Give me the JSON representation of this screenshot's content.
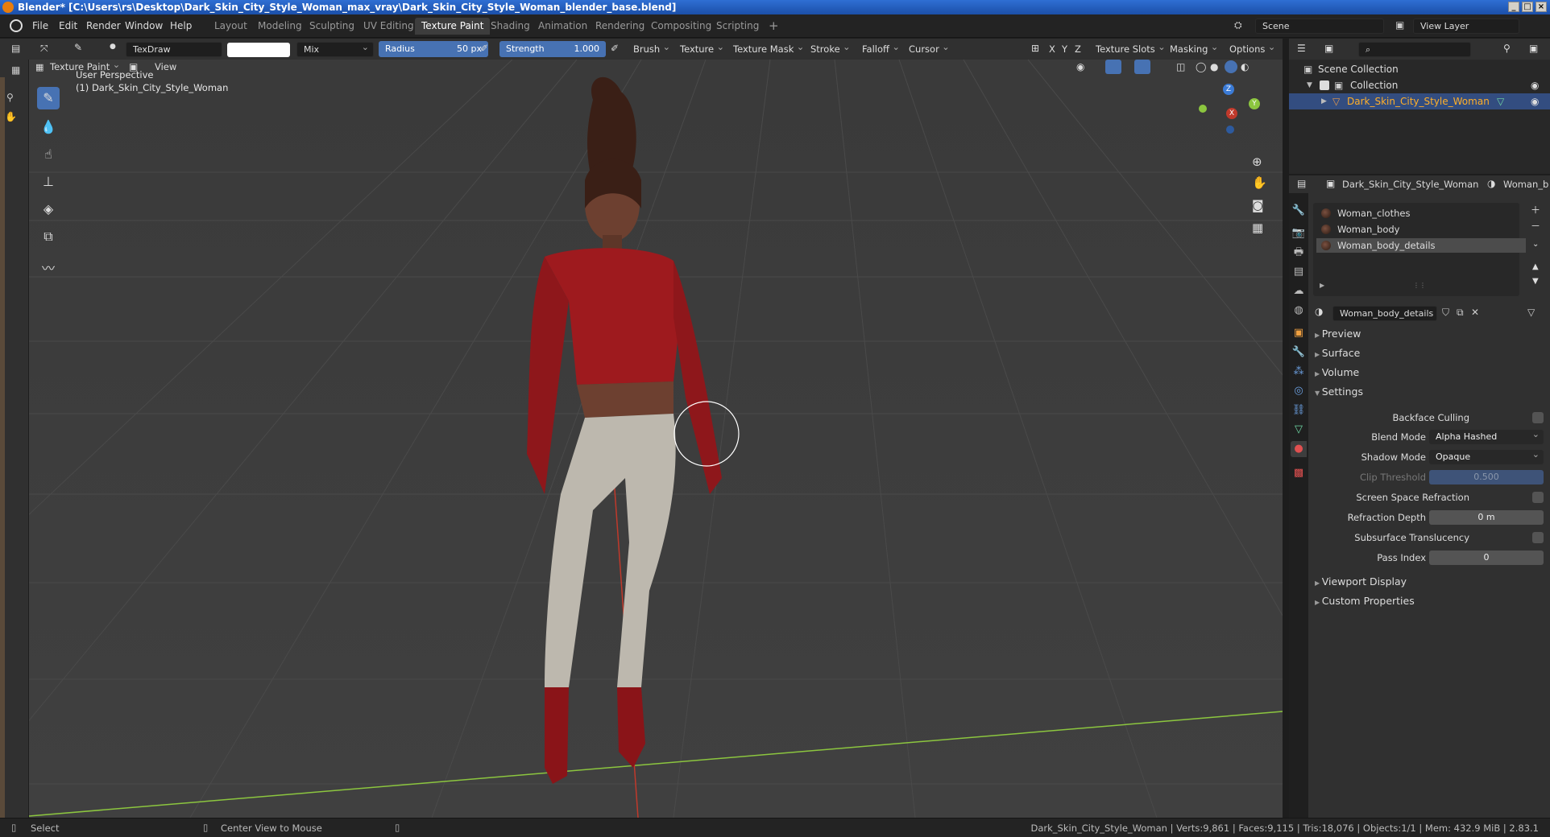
{
  "window": {
    "title": "Blender* [C:\\Users\\rs\\Desktop\\Dark_Skin_City_Style_Woman_max_vray\\Dark_Skin_City_Style_Woman_blender_base.blend]",
    "controls": [
      "_",
      "□",
      "×"
    ]
  },
  "menu": [
    "File",
    "Edit",
    "Render",
    "Window",
    "Help"
  ],
  "workspaces": [
    {
      "label": "Layout",
      "active": false
    },
    {
      "label": "Modeling",
      "active": false
    },
    {
      "label": "Sculpting",
      "active": false
    },
    {
      "label": "UV Editing",
      "active": false
    },
    {
      "label": "Texture Paint",
      "active": true
    },
    {
      "label": "Shading",
      "active": false
    },
    {
      "label": "Animation",
      "active": false
    },
    {
      "label": "Rendering",
      "active": false
    },
    {
      "label": "Compositing",
      "active": false
    },
    {
      "label": "Scripting",
      "active": false
    }
  ],
  "add_workspace": "+",
  "scene": "Scene",
  "view_layer": "View Layer",
  "tool_header": {
    "brush_name": "TexDraw",
    "blend": "Mix",
    "radius_label": "Radius",
    "radius_value": "50 px",
    "strength_label": "Strength",
    "strength_value": "1.000",
    "strength_fraction": 1.0,
    "menus": [
      "Brush",
      "Texture",
      "Texture Mask",
      "Stroke",
      "Falloff",
      "Cursor"
    ],
    "axes": [
      "X",
      "Y",
      "Z"
    ],
    "texture_slots": "Texture Slots",
    "masking": "Masking",
    "options": "Options"
  },
  "mode_header": {
    "mode": "Texture Paint",
    "view": "View"
  },
  "viewport": {
    "perspective": "User Perspective",
    "object": "(1) Dark_Skin_City_Style_Woman",
    "gizmo_axes": [
      "Z",
      "Y",
      "X"
    ]
  },
  "outliner": {
    "search_placeholder": "",
    "scene_collection": "Scene Collection",
    "collection": "Collection",
    "object": "Dark_Skin_City_Style_Woman"
  },
  "properties": {
    "object_name": "Dark_Skin_City_Style_Woman",
    "material_tab": "Woman_b",
    "materials": [
      {
        "name": "Woman_clothes",
        "selected": false
      },
      {
        "name": "Woman_body",
        "selected": false
      },
      {
        "name": "Woman_body_details",
        "selected": true
      }
    ],
    "active_material": "Woman_body_details",
    "panels": {
      "preview": "Preview",
      "surface": "Surface",
      "volume": "Volume",
      "settings": "Settings",
      "viewport_display": "Viewport Display",
      "custom_properties": "Custom Properties"
    },
    "settings": {
      "backface_culling": "Backface Culling",
      "blend_mode_label": "Blend Mode",
      "blend_mode": "Alpha Hashed",
      "shadow_mode_label": "Shadow Mode",
      "shadow_mode": "Opaque",
      "clip_threshold_label": "Clip Threshold",
      "clip_threshold": "0.500",
      "ssr_label": "Screen Space Refraction",
      "refraction_depth_label": "Refraction Depth",
      "refraction_depth": "0 m",
      "subsurface_label": "Subsurface Translucency",
      "pass_index_label": "Pass Index",
      "pass_index": "0"
    }
  },
  "status": {
    "select": "Select",
    "center_view": "Center View to Mouse",
    "stats": "Dark_Skin_City_Style_Woman | Verts:9,861 | Faces:9,115 | Tris:18,076 | Objects:1/1 | Mem: 432.9 MiB | 2.83.1"
  },
  "colors": {
    "accent": "#4772b3",
    "shirt": "#9e1a1e",
    "pants": "#bdb8ae",
    "boots": "#8a1418",
    "x_axis": "#c0392b",
    "y_axis": "#8cc63f"
  }
}
